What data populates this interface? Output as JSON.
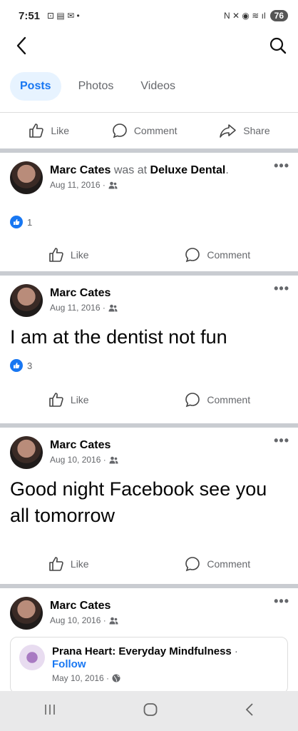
{
  "status_bar": {
    "time": "7:51",
    "battery": "76"
  },
  "nav": {
    "back_icon": "back-arrow-icon",
    "search_icon": "search-icon"
  },
  "tabs": [
    {
      "label": "Posts"
    },
    {
      "label": "Photos"
    },
    {
      "label": "Videos"
    }
  ],
  "top_actions": {
    "like": "Like",
    "comment": "Comment",
    "share": "Share"
  },
  "posts": [
    {
      "author": "Marc Cates",
      "connector": " was at ",
      "place": "Deluxe Dental",
      "trailing": ".",
      "date": "Aug 11, 2016 ·",
      "reactions": "1",
      "like": "Like",
      "comment": "Comment"
    },
    {
      "author": "Marc Cates",
      "date": "Aug 11, 2016 ·",
      "text": "I am at the dentist not fun",
      "reactions": "3",
      "like": "Like",
      "comment": "Comment"
    },
    {
      "author": "Marc Cates",
      "date": "Aug 10, 2016 ·",
      "text": "Good night Facebook see you all tomorrow",
      "like": "Like",
      "comment": "Comment"
    },
    {
      "author": "Marc Cates",
      "date": "Aug 10, 2016 ·",
      "shared": {
        "page_name": "Prana Heart: Everyday Mindfulness",
        "dot": " ·",
        "follow": "Follow",
        "date": "May 10, 2016 ·"
      }
    }
  ],
  "more_glyph": "•••",
  "colors": {
    "accent": "#1877f2",
    "muted": "#65676b",
    "separator": "#c9ccd1"
  }
}
